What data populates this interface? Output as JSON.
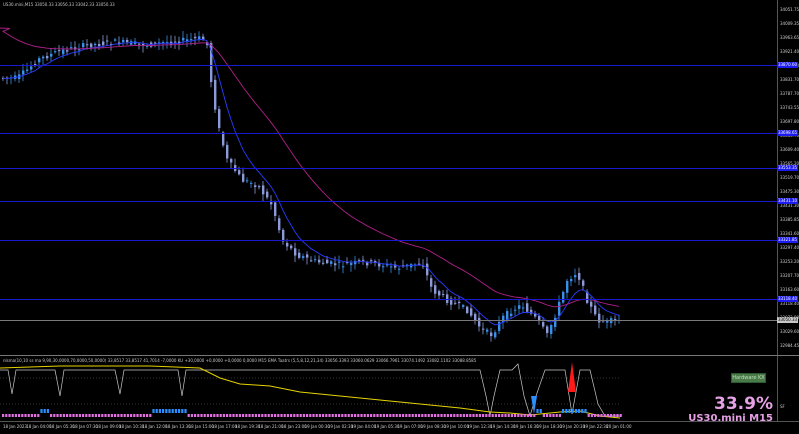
{
  "header": {
    "symbol_line": "US30.mini,M15  33050.33 33056.33 33042.33 33050.33",
    "indicator_line": "nlsma(10,10 ss ma 9,90,30,0000,70,0000,50,0000) 33,8517 33,8517 41,7014 -7,0000  KU +30,0000 +0,0000 +0,0000 0,0000  M15 EMA Taatrs (5,5,8,12,21,34) 33056.3393 33060.0629 33066.7961 33074.1492 33082.1102 33088.8585"
  },
  "price_axis": {
    "labels": [
      "34051.75",
      "34009.35",
      "33963.65",
      "33921.40",
      "33879.40",
      "33831.70",
      "33787.70",
      "33743.55",
      "33697.80",
      "33653.75",
      "33609.40",
      "33565.20",
      "33519.70",
      "33475.30",
      "33431.30",
      "33385.85",
      "33341.60",
      "33297.40",
      "33253.20",
      "33207.70",
      "33163.60",
      "33118.40",
      "33073.80",
      "33029.60",
      "32984.45"
    ],
    "level_tags": [
      "33870.60",
      "33698.65",
      "33553.35",
      "33431.10",
      "33321.85",
      "33118.40"
    ],
    "current_price": "33050.33"
  },
  "time_axis": {
    "labels": [
      "18 Jan 2023",
      "18 Jan 04:00",
      "18 Jan 05:30",
      "18 Jan 07:30",
      "18 Jan 09:00",
      "18 Jan 10:30",
      "18 Jan 12:00",
      "18 Jan 13:30",
      "18 Jan 15:00",
      "18 Jan 17:00",
      "18 Jan 19:30",
      "18 Jan 21:00",
      "18 Jan 23:00",
      "19 Jan 00:30",
      "19 Jan 02:30",
      "19 Jan 04:00",
      "19 Jan 05:30",
      "19 Jan 07:00",
      "19 Jan 08:30",
      "19 Jan 10:00",
      "19 Jan 12:30",
      "19 Jan 14:30",
      "19 Jan 16:30",
      "19 Jan 18:30",
      "19 Jan 20:30",
      "19 Jan 22:30",
      "20 Jan 01:00"
    ]
  },
  "indicator": {
    "button_label": "Hardware KX",
    "sub_axis_label": "SF"
  },
  "watermark": {
    "percent": "33.9%",
    "symbol": "US30.mini M15"
  },
  "colors": {
    "candle": "#8b9ad8",
    "candle_bull": "#3a8fe8",
    "ema_fast": "#2a3cff",
    "ema_slow": "#b0208a",
    "level": "#1818d0",
    "sub_yellow": "#e6d400",
    "sub_white": "#c8c8c8",
    "sub_pink": "#e070e0",
    "sub_blue": "#2b8fff",
    "sub_red": "#ff1a1a"
  }
}
